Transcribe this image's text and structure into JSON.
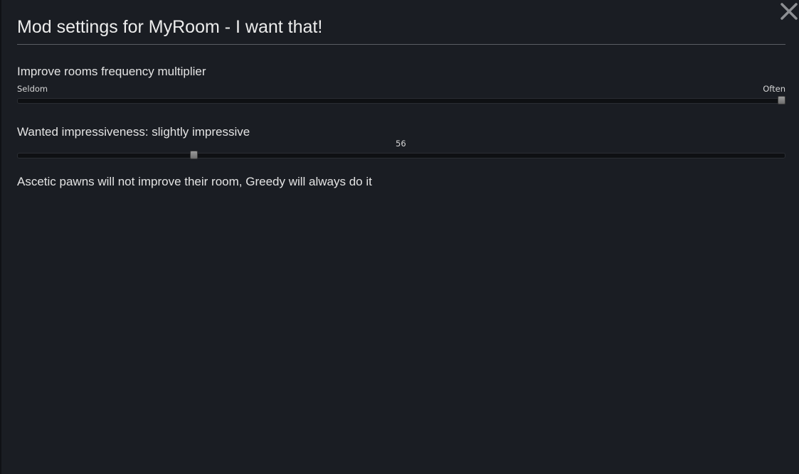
{
  "dialog": {
    "title": "Mod settings for MyRoom - I want that!"
  },
  "settings": {
    "frequency": {
      "label": "Improve rooms frequency multiplier",
      "min_label": "Seldom",
      "max_label": "Often",
      "value_fraction": 1.0
    },
    "impressiveness": {
      "label": "Wanted impressiveness: slightly impressive",
      "value_text": "56",
      "value_fraction": 0.227
    },
    "note": "Ascetic pawns will not improve their room, Greedy will always do it"
  },
  "icons": {
    "close": "close-icon"
  }
}
